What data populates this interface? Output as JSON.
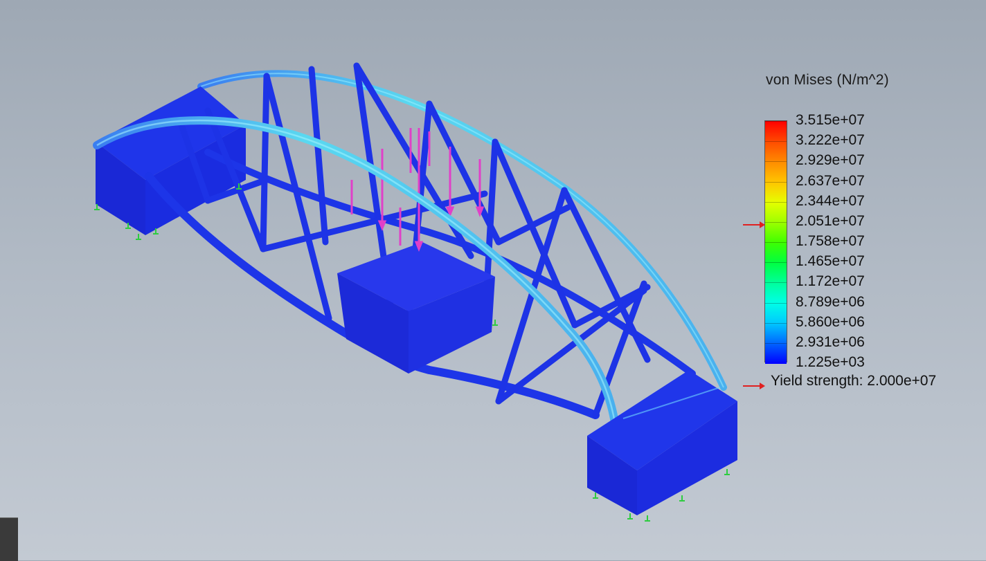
{
  "legend": {
    "title": "von Mises (N/m^2)",
    "ticks": [
      "3.515e+07",
      "3.222e+07",
      "2.929e+07",
      "2.637e+07",
      "2.344e+07",
      "2.051e+07",
      "1.758e+07",
      "1.465e+07",
      "1.172e+07",
      "8.789e+06",
      "5.860e+06",
      "2.931e+06",
      "1.225e+03"
    ],
    "colors": [
      "#ff0000",
      "#ff4a00",
      "#ff8a00",
      "#ffc400",
      "#e6ff00",
      "#9dff00",
      "#40ff00",
      "#00ff40",
      "#00ff9a",
      "#00ffe6",
      "#00c8ff",
      "#0066ff",
      "#0000ff"
    ],
    "yield_label": "Yield strength: 2.000e+07",
    "yield_marker_color": "#e02020",
    "yield_value": 20000000
  },
  "model": {
    "description_icon": "truss-bridge-stress-plot",
    "primary_color": "#1a2fe0",
    "highlight_color": "#5ad8f0",
    "load_arrow_color": "#e040c8",
    "fixture_color": "#2ecc40"
  }
}
